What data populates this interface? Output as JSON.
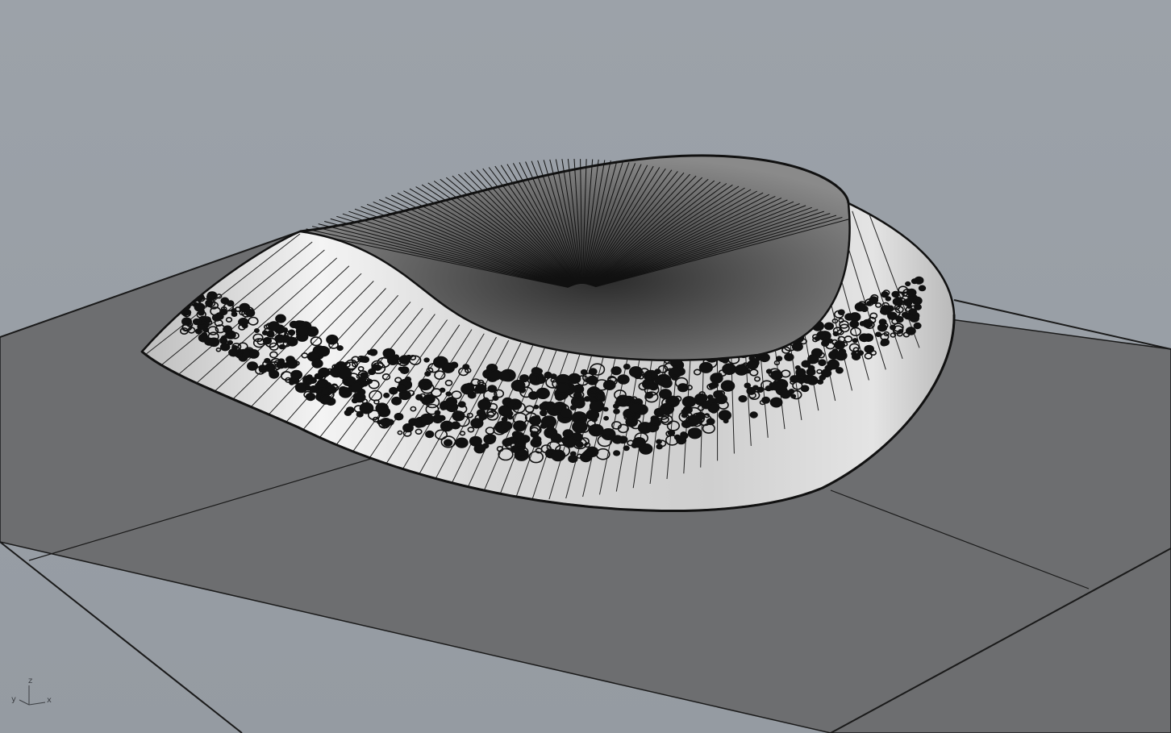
{
  "viewport": {
    "background_color": "#9aa0a7",
    "ground_plane_color": "#6d6e70",
    "ground_plane_edge_color": "#1a1a1a",
    "surface_color": "#d6d6d6",
    "perforation_color": "#111111",
    "wire_color": "#111111"
  },
  "axis_widget": {
    "z_label": "z",
    "y_label": "y",
    "x_label": "x"
  }
}
